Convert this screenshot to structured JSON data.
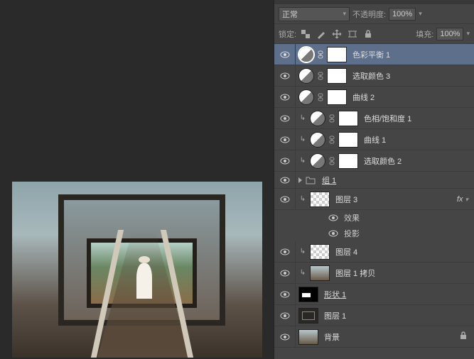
{
  "toolbar": {
    "blend_mode": "正常",
    "opacity_label": "不透明度:",
    "opacity_value": "100%",
    "lock_label": "锁定:",
    "fill_label": "填充:",
    "fill_value": "100%"
  },
  "layers": [
    {
      "name": "色彩平衡 1",
      "type": "adj",
      "selected": true
    },
    {
      "name": "选取颜色 3",
      "type": "adj"
    },
    {
      "name": "曲线 2",
      "type": "adj"
    },
    {
      "name": "色相/饱和度 1",
      "type": "adj",
      "clipped": true
    },
    {
      "name": "曲线 1",
      "type": "adj",
      "clipped": true
    },
    {
      "name": "选取颜色 2",
      "type": "adj",
      "clipped": true
    },
    {
      "name": "组 1",
      "type": "group"
    },
    {
      "name": "图层 3",
      "type": "pixel",
      "clipped": true,
      "thumb": "checker",
      "fx": true
    },
    {
      "name": "图层 4",
      "type": "pixel",
      "clipped": true,
      "thumb": "checker"
    },
    {
      "name": "图层 1 拷贝",
      "type": "pixel",
      "clipped": true,
      "thumb": "img1"
    },
    {
      "name": "形状 1",
      "type": "shape",
      "thumb": "shape",
      "mask": true
    },
    {
      "name": "图层 1",
      "type": "pixel",
      "thumb": "img2"
    },
    {
      "name": "背景",
      "type": "pixel",
      "thumb": "img1",
      "locked": true
    }
  ],
  "fx": {
    "effects_label": "效果",
    "drop_shadow": "投影"
  }
}
